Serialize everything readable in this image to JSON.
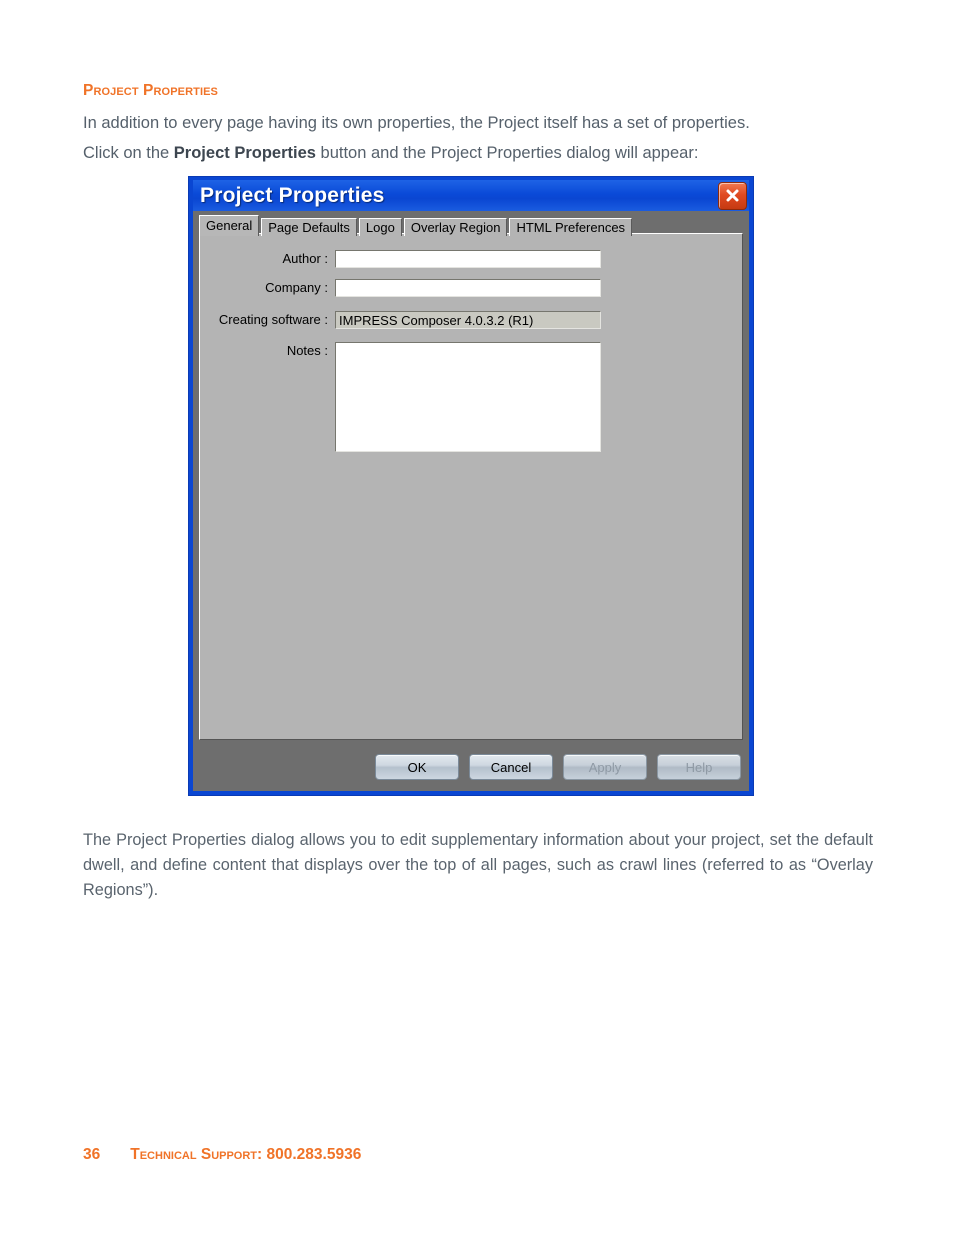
{
  "document": {
    "section_heading": "Project Properties",
    "intro_line1": "In addition to every page having its own properties, the Project itself has a set of properties.",
    "intro_line2_pre": "Click on the ",
    "intro_line2_bold": "Project Properties",
    "intro_line2_post": " button and the Project Properties dialog will appear:",
    "outro": "The Project Properties dialog allows you to edit supplementary information about your project, set the default dwell, and define content that displays over the top of all pages, such as crawl lines (referred to as “Overlay Regions”).",
    "footer_page": "36",
    "footer_support": "Technical Support: 800.283.5936",
    "accent_color": "#f07328",
    "body_text_color": "#55606b"
  },
  "dialog": {
    "title": "Project Properties",
    "close_icon": "close-icon",
    "titlebar_color": "#0a46d2",
    "panel_color": "#b4b4b4",
    "tabs": [
      {
        "label": "General",
        "active": true
      },
      {
        "label": "Page Defaults",
        "active": false
      },
      {
        "label": "Logo",
        "active": false
      },
      {
        "label": "Overlay Region",
        "active": false
      },
      {
        "label": "HTML Preferences",
        "active": false
      }
    ],
    "fields": {
      "author_label": "Author :",
      "author_value": "",
      "company_label": "Company :",
      "company_value": "",
      "creating_software_label": "Creating software :",
      "creating_software_value": "IMPRESS Composer 4.0.3.2 (R1)",
      "notes_label": "Notes :",
      "notes_value": ""
    },
    "buttons": {
      "ok": "OK",
      "cancel": "Cancel",
      "apply": "Apply",
      "help": "Help"
    }
  }
}
